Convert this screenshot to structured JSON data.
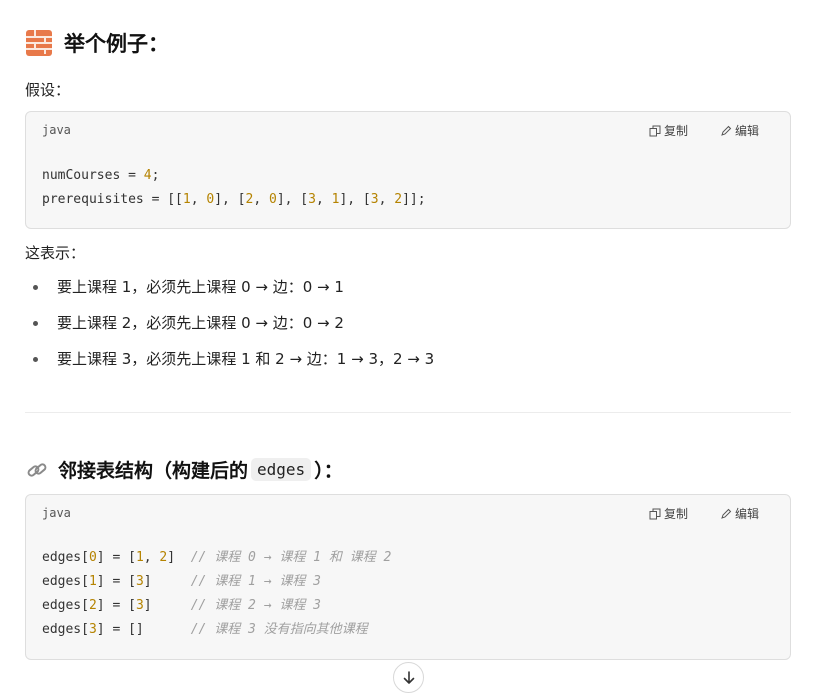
{
  "section1": {
    "title": "举个例子：",
    "intro": "假设：",
    "code": {
      "lang": "java",
      "copy_label": "复制",
      "edit_label": "编辑",
      "lines": [
        {
          "parts": [
            {
              "t": "numCourses = "
            },
            {
              "t": "4",
              "k": "n"
            },
            {
              "t": ";"
            }
          ]
        },
        {
          "parts": [
            {
              "t": "prerequisites = [["
            },
            {
              "t": "1",
              "k": "n"
            },
            {
              "t": ", "
            },
            {
              "t": "0",
              "k": "n"
            },
            {
              "t": "], ["
            },
            {
              "t": "2",
              "k": "n"
            },
            {
              "t": ", "
            },
            {
              "t": "0",
              "k": "n"
            },
            {
              "t": "], ["
            },
            {
              "t": "3",
              "k": "n"
            },
            {
              "t": ", "
            },
            {
              "t": "1",
              "k": "n"
            },
            {
              "t": "], ["
            },
            {
              "t": "3",
              "k": "n"
            },
            {
              "t": ", "
            },
            {
              "t": "2",
              "k": "n"
            },
            {
              "t": "]];"
            }
          ]
        }
      ]
    },
    "means_label": "这表示：",
    "bullets": [
      "要上课程 1，必须先上课程 0 → 边：0 → 1",
      "要上课程 2，必须先上课程 0 → 边：0 → 2",
      "要上课程 3，必须先上课程 1 和 2 → 边：1 → 3，2 → 3"
    ]
  },
  "section2": {
    "title_prefix": "邻接表结构（构建后的",
    "title_code": "edges",
    "title_suffix": "）：",
    "code": {
      "lang": "java",
      "copy_label": "复制",
      "edit_label": "编辑",
      "lines": [
        {
          "parts": [
            {
              "t": "edges["
            },
            {
              "t": "0",
              "k": "n"
            },
            {
              "t": "] = ["
            },
            {
              "t": "1",
              "k": "n"
            },
            {
              "t": ", "
            },
            {
              "t": "2",
              "k": "n"
            },
            {
              "t": "]  "
            },
            {
              "t": "// 课程 0 → 课程 1 和 课程 2",
              "k": "c"
            }
          ]
        },
        {
          "parts": [
            {
              "t": "edges["
            },
            {
              "t": "1",
              "k": "n"
            },
            {
              "t": "] = ["
            },
            {
              "t": "3",
              "k": "n"
            },
            {
              "t": "]     "
            },
            {
              "t": "// 课程 1 → 课程 3",
              "k": "c"
            }
          ]
        },
        {
          "parts": [
            {
              "t": "edges["
            },
            {
              "t": "2",
              "k": "n"
            },
            {
              "t": "] = ["
            },
            {
              "t": "3",
              "k": "n"
            },
            {
              "t": "]     "
            },
            {
              "t": "// 课程 2 → 课程 3",
              "k": "c"
            }
          ]
        },
        {
          "parts": [
            {
              "t": "edges["
            },
            {
              "t": "3",
              "k": "n"
            },
            {
              "t": "] = []      "
            },
            {
              "t": "// 课程 3 没有指向其他课程",
              "k": "c"
            }
          ]
        }
      ]
    }
  },
  "icons": {
    "section1_icon": "brick-icon",
    "section2_icon": "link-icon",
    "copy_icon": "copy-icon",
    "edit_icon": "pencil-icon",
    "scroll_icon": "arrow-down-icon"
  }
}
